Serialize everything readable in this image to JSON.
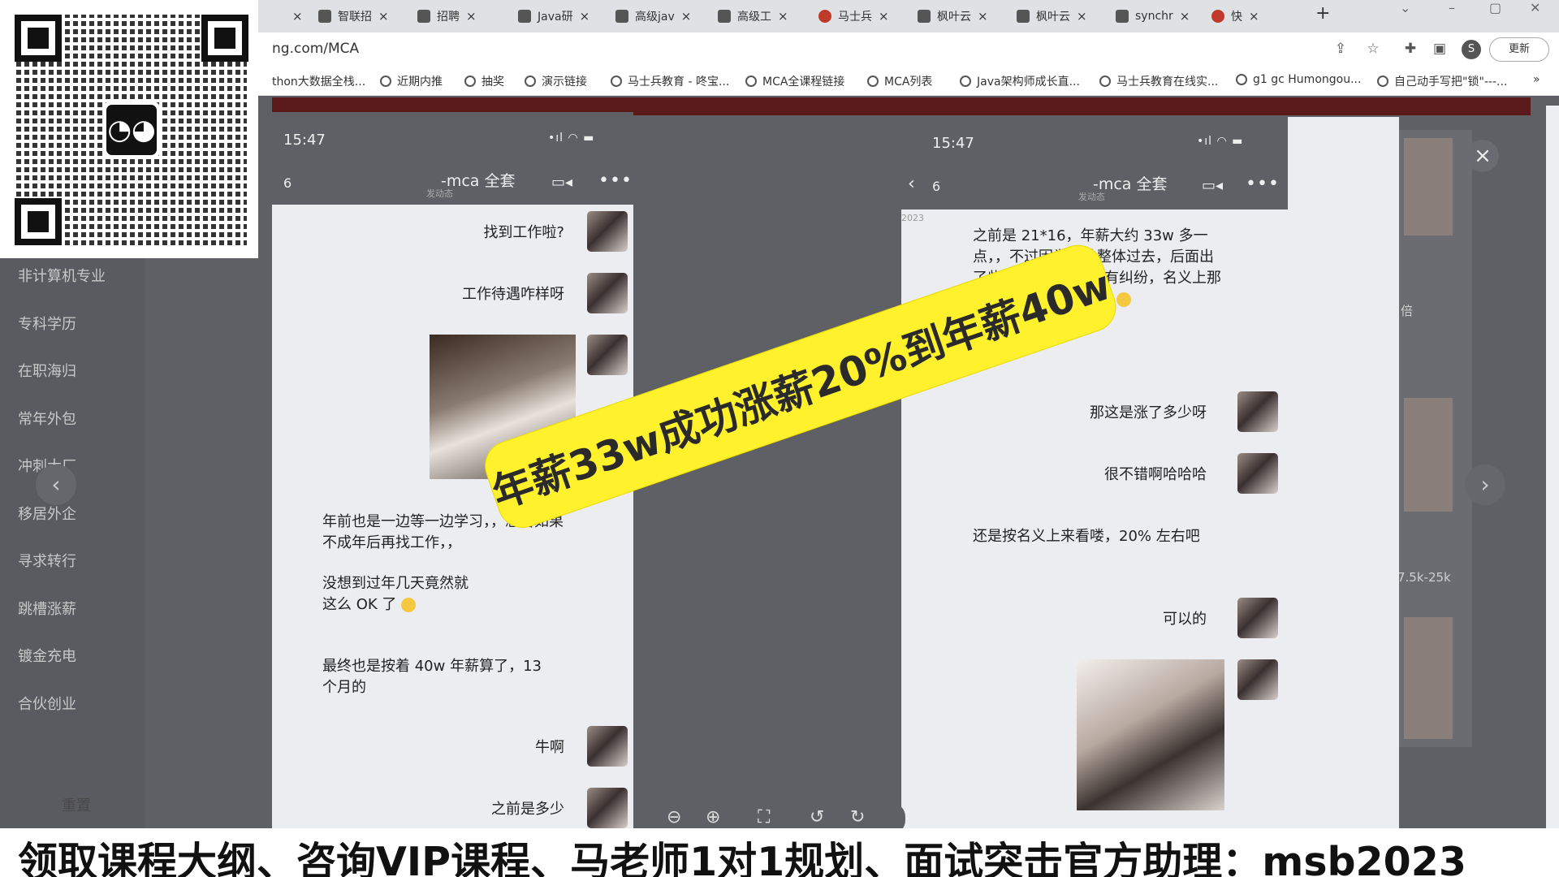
{
  "browser": {
    "tabs": [
      {
        "label": "智联招",
        "icon": "page-icon"
      },
      {
        "label": "招聘",
        "icon": "page-icon"
      },
      {
        "label": "Java研",
        "icon": "page-icon"
      },
      {
        "label": "高级jav",
        "icon": "page-icon"
      },
      {
        "label": "高级工",
        "icon": "page-icon"
      },
      {
        "label": "马士兵",
        "icon": "site-icon"
      },
      {
        "label": "枫叶云",
        "icon": "page-icon"
      },
      {
        "label": "枫叶云",
        "icon": "page-icon"
      },
      {
        "label": "synchr",
        "icon": "page-icon"
      },
      {
        "label": "快",
        "icon": "site-icon"
      }
    ],
    "close_glyph": "×",
    "new_tab_glyph": "+",
    "url": "ng.com/MCA",
    "profile_initial": "S",
    "update_label": "更新",
    "bookmarks": [
      "thon大数据全栈...",
      "近期内推",
      "抽奖",
      "演示链接",
      "马士兵教育 - 咚宝...",
      "MCA全课程链接",
      "MCA列表",
      "Java架构师成长直...",
      "马士兵教育在线实...",
      "g1 gc Humongou...",
      "自己动手写把\"锁\"---..."
    ],
    "bookmarks_more": "»"
  },
  "sidebar": {
    "items": [
      "非计算机专业",
      "专科学历",
      "在职海归",
      "常年外包",
      "冲刺大厂",
      "移居外企",
      "寻求转行",
      "跳槽涨薪",
      "镀金充电",
      "合伙创业"
    ],
    "reset_label": "重置"
  },
  "left_phone": {
    "time": "15:47",
    "status": "•ıl ◠ ▬",
    "unread": "6",
    "title": "-mca 全套",
    "subtitle": "发动态",
    "messages_right": [
      "找到工作啦?",
      "工作待遇咋样呀",
      "牛啊",
      "之前是多少"
    ],
    "messages_left": [
      "年前也是一边等一边学习，，想着如果不成年后再找工作，，",
      "没想到过年几天竟然就这么 OK 了",
      "最终也是按着 40w 年薪算了，13 个月的"
    ]
  },
  "right_phone": {
    "time": "15:47",
    "status": "•ıl ◠ ▬",
    "back": "‹",
    "unread": "6",
    "title": "-mca 全套",
    "subtitle": "发动态",
    "stamp": "2023",
    "messages_left": [
      "之前是 21*16，年薪大约 33w 多一点，，不过因为团队整体过去，后面出了些变故，跟公司还有纠纷，名义上那么多，，实际也是惨淡",
      "还是按名义上来看喽，20% 左右吧"
    ],
    "messages_right": [
      "那这是涨了多少呀",
      "很不错啊哈哈哈",
      "可以的"
    ]
  },
  "viewer": {
    "tools": [
      "⊖",
      "⊕",
      "⛶",
      "↺",
      "↻"
    ],
    "close": "×",
    "prev": "‹",
    "next": "›"
  },
  "right_strip": {
    "texts": [
      "倍",
      "7.5k-25k"
    ]
  },
  "overlays": {
    "yellow_banner": "年薪33w成功涨薪20%到年薪40w",
    "bottom_banner": "领取课程大纲、咨询VIP课程、马老师1对1规划、面试突击官方助理：msb2023"
  },
  "colors": {
    "banner_yellow": "#fff12b",
    "dim_overlay": "#5f6066",
    "chat_bg": "#ebedf0"
  }
}
